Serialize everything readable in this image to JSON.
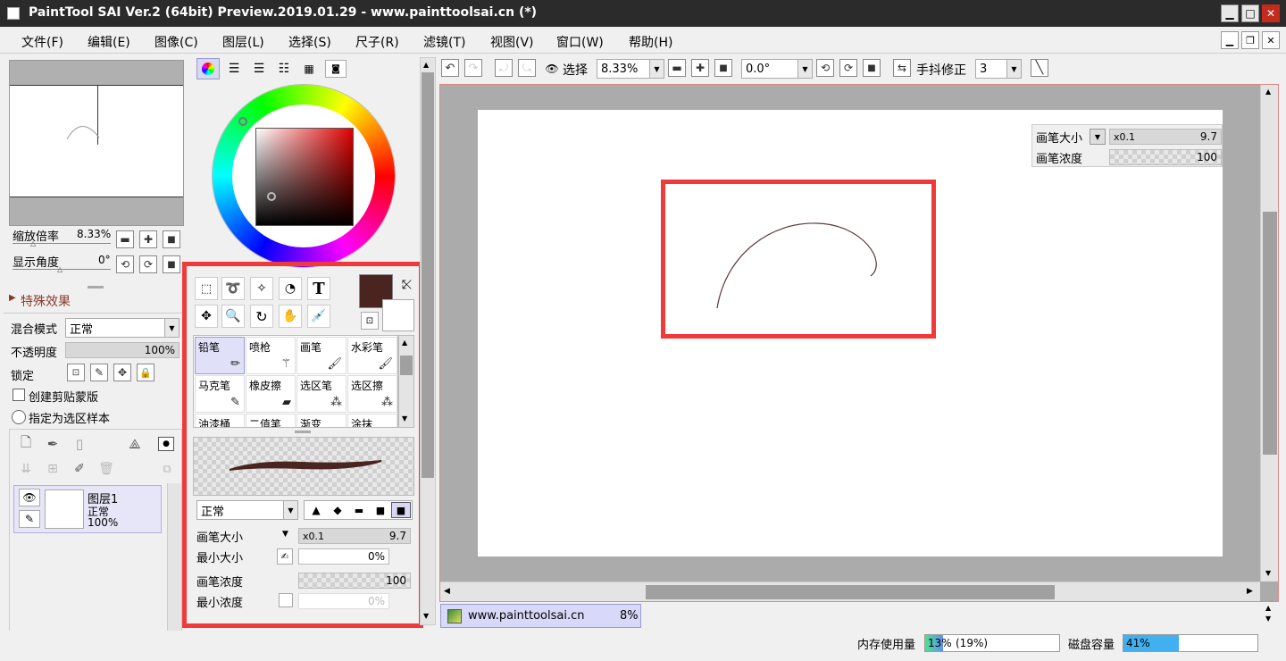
{
  "window": {
    "title": "PaintTool SAI Ver.2 (64bit) Preview.2019.01.29 - www.painttoolsai.cn (*)"
  },
  "menu": [
    {
      "label": "文件(F)"
    },
    {
      "label": "编辑(E)"
    },
    {
      "label": "图像(C)"
    },
    {
      "label": "图层(L)"
    },
    {
      "label": "选择(S)"
    },
    {
      "label": "尺子(R)"
    },
    {
      "label": "滤镜(T)"
    },
    {
      "label": "视图(V)"
    },
    {
      "label": "窗口(W)"
    },
    {
      "label": "帮助(H)"
    }
  ],
  "navigator": {
    "zoom_label": "缩放倍率",
    "zoom_value": "8.33%",
    "angle_label": "显示角度",
    "angle_value": "0°"
  },
  "layer_props": {
    "effects_label": "特殊效果",
    "blend_label": "混合模式",
    "blend_value": "正常",
    "opacity_label": "不透明度",
    "opacity_value": "100%",
    "lock_label": "锁定",
    "clip_label": "创建剪贴蒙版",
    "sample_label": "指定为选区样本"
  },
  "layer": {
    "name": "图层1",
    "mode": "正常",
    "opacity": "100%"
  },
  "tools": {
    "text_tool": "T"
  },
  "colors": {
    "primary": "#4a2520",
    "highlight": "#f03a3a"
  },
  "brushes": [
    {
      "label": "铅笔"
    },
    {
      "label": "喷枪"
    },
    {
      "label": "画笔"
    },
    {
      "label": "水彩笔"
    },
    {
      "label": "马克笔"
    },
    {
      "label": "橡皮擦"
    },
    {
      "label": "选区笔"
    },
    {
      "label": "选区擦"
    },
    {
      "label": "油漆桶"
    },
    {
      "label": "二值笔"
    },
    {
      "label": "渐变"
    },
    {
      "label": "涂抹"
    }
  ],
  "brush_settings": {
    "mode": "正常",
    "size_label": "画笔大小",
    "size_mult": "x0.1",
    "size_value": "9.7",
    "min_size_label": "最小大小",
    "min_size_value": "0%",
    "density_label": "画笔浓度",
    "density_value": "100",
    "min_density_label": "最小浓度",
    "min_density_value": "0%"
  },
  "canvas_toolbar": {
    "select_label": "选择",
    "zoom_value": "8.33%",
    "angle_value": "0.0°",
    "stabilizer_label": "手抖修正",
    "stabilizer_value": "3"
  },
  "floating_brush": {
    "size_label": "画笔大小",
    "size_mult": "x0.1",
    "size_value": "9.7",
    "density_label": "画笔浓度",
    "density_value": "100"
  },
  "doc_tab": {
    "name": "www.painttoolsai.cn",
    "zoom": "8%"
  },
  "status": {
    "mem_label": "内存使用量",
    "mem_value": "13%",
    "mem_extra": "(19%)",
    "mem_fraction": 0.13,
    "disk_label": "磁盘容量",
    "disk_value": "41%",
    "disk_fraction": 0.41
  }
}
